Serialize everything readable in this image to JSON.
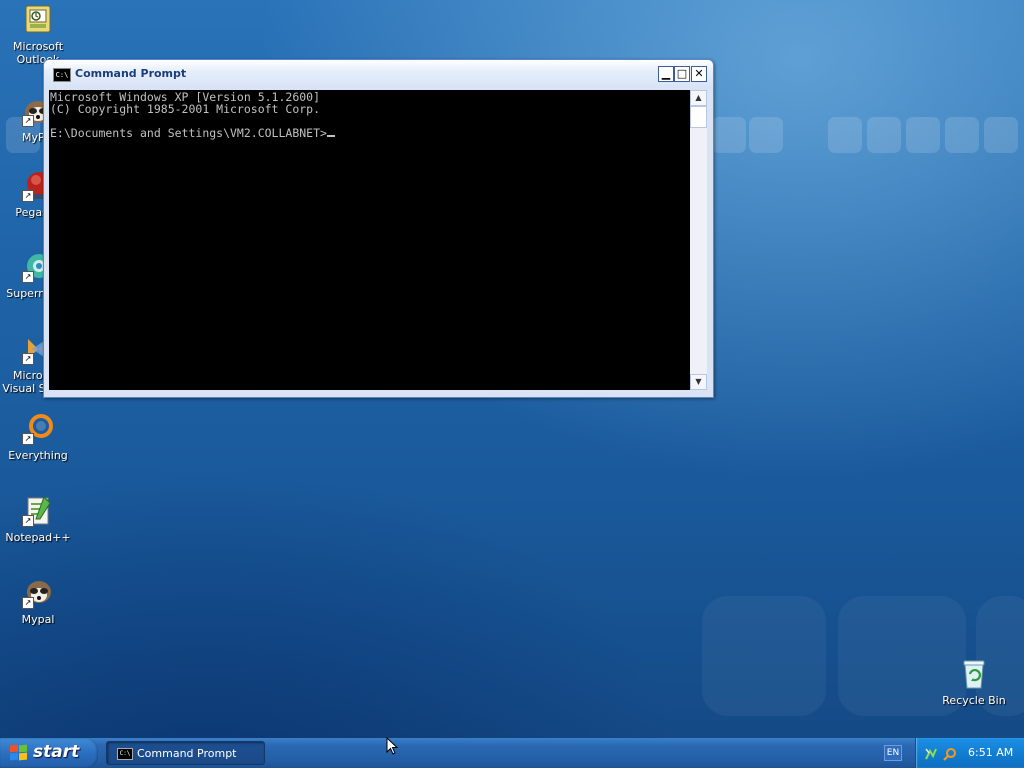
{
  "desktop": {
    "icons": [
      {
        "label": "Microsoft Outlook",
        "icon": "outlook-icon"
      },
      {
        "label": "MyPal",
        "icon": "mypal-icon"
      },
      {
        "label": "Pegasus",
        "icon": "pegasus-icon"
      },
      {
        "label": "Supermium",
        "icon": "supermium-icon"
      },
      {
        "label": "Microsoft Visual Studio",
        "icon": "visual-studio-icon"
      },
      {
        "label": "Everything",
        "icon": "everything-icon"
      },
      {
        "label": "Notepad++",
        "icon": "notepad-plus-plus-icon"
      },
      {
        "label": "Mypal",
        "icon": "mypal-icon"
      },
      {
        "label": "Recycle Bin",
        "icon": "recycle-bin-icon"
      }
    ]
  },
  "window": {
    "title": "Command Prompt",
    "icon_text": "C:\\",
    "console_lines": [
      "Microsoft Windows XP [Version 5.1.2600]",
      "(C) Copyright 1985-2001 Microsoft Corp.",
      "",
      "E:\\Documents and Settings\\VM2.COLLABNET>"
    ],
    "background_color": "#000000",
    "text_color": "#c0c0c0"
  },
  "taskbar": {
    "start_label": "start",
    "task_items": [
      {
        "label": "Command Prompt",
        "icon_text": "C:\\"
      }
    ],
    "language": "EN",
    "clock": "6:51 AM"
  }
}
